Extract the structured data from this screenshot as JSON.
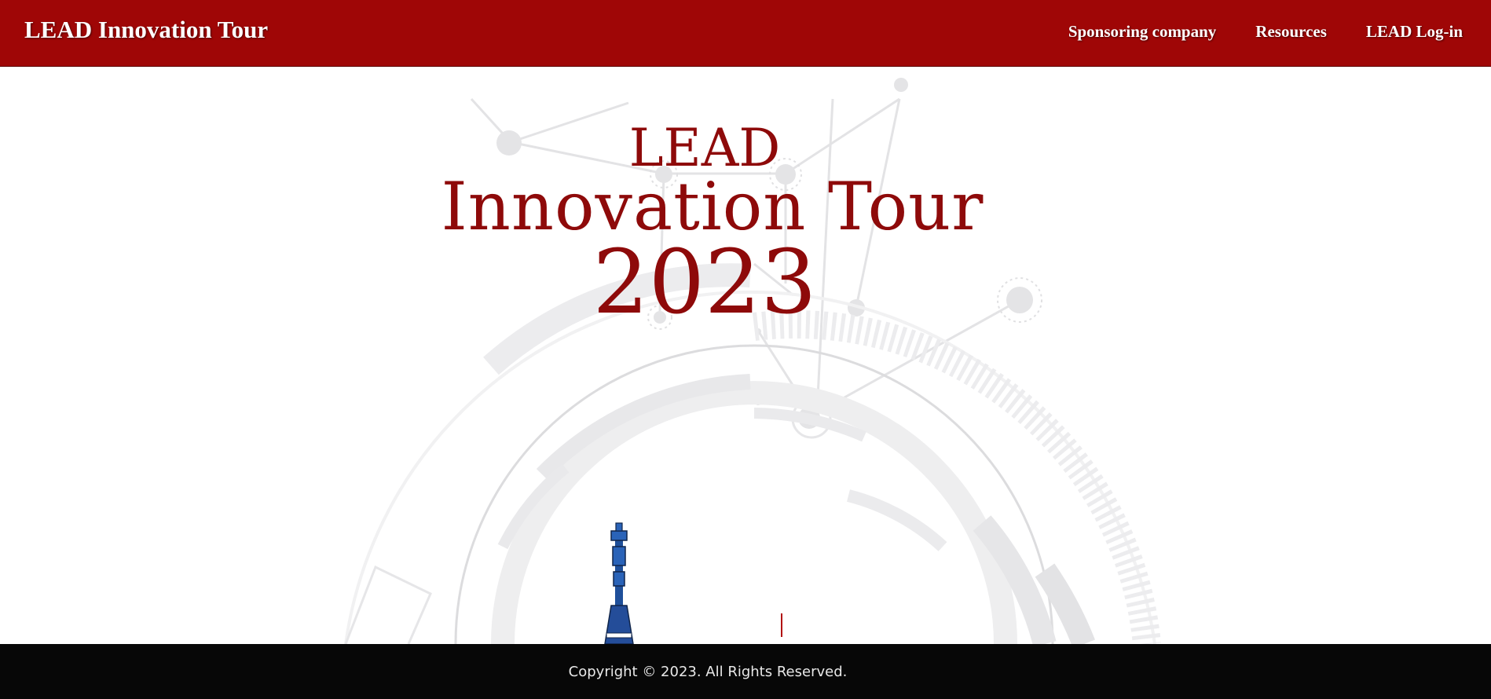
{
  "header": {
    "brand": "LEAD Innovation Tour",
    "nav": [
      {
        "label": "Sponsoring company"
      },
      {
        "label": "Resources"
      },
      {
        "label": "LEAD Log-in"
      }
    ]
  },
  "hero": {
    "line1": "LEAD",
    "line2": "Innovation Tour",
    "line3": "2023"
  },
  "footer": {
    "copyright": "Copyright © 2023. All Rights Reserved."
  },
  "colors": {
    "header_bg": "#9f0606",
    "title": "#8e0a0a",
    "footer_bg": "#070707"
  },
  "icons": {
    "hero_graphic": "tech-circle-graphic",
    "tower": "tv-tower-icon"
  }
}
